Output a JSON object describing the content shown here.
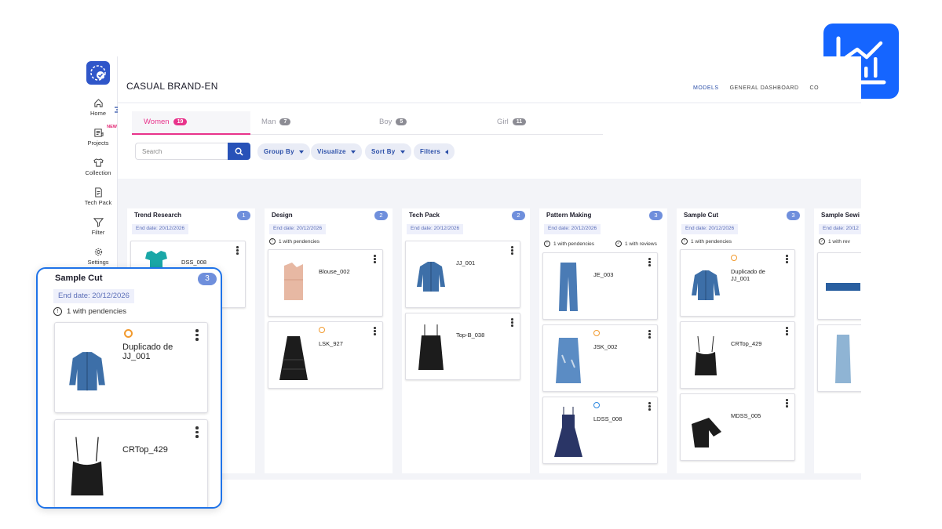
{
  "app": {
    "brand": "CASUAL BRAND-EN",
    "top_nav": [
      "MODELS",
      "GENERAL DASHBOARD",
      "CO"
    ],
    "top_nav_active": "MODELS"
  },
  "sidebar": {
    "items": [
      {
        "label": "Home",
        "icon": "home-icon"
      },
      {
        "label": "Projects",
        "icon": "projects-icon",
        "badge": "NEW"
      },
      {
        "label": "Collection",
        "icon": "shirt-icon"
      },
      {
        "label": "Tech Pack",
        "icon": "techpack-icon"
      },
      {
        "label": "Filter",
        "icon": "filter-icon"
      },
      {
        "label": "Settings",
        "icon": "gear-icon"
      }
    ]
  },
  "tabs": [
    {
      "label": "Women",
      "count": "19"
    },
    {
      "label": "Man",
      "count": "7"
    },
    {
      "label": "Boy",
      "count": "5"
    },
    {
      "label": "Girl",
      "count": "11"
    }
  ],
  "search": {
    "placeholder": "Search"
  },
  "toolbar": {
    "group_by": "Group By",
    "visualize": "Visualize",
    "sort_by": "Sort By",
    "filters": "Filters"
  },
  "columns": [
    {
      "title": "Trend Research",
      "count": "1",
      "end_date": "End date: 20/12/2026",
      "cards": [
        {
          "name": "DSS_008"
        }
      ]
    },
    {
      "title": "Design",
      "count": "2",
      "end_date": "End date: 20/12/2026",
      "pendencies": "1 with pendencies",
      "cards": [
        {
          "name": "Blouse_002"
        },
        {
          "name": "LSK_927",
          "status": "orange"
        }
      ]
    },
    {
      "title": "Tech Pack",
      "count": "2",
      "end_date": "End date: 20/12/2026",
      "cards": [
        {
          "name": "JJ_001"
        },
        {
          "name": "Top-B_038"
        }
      ]
    },
    {
      "title": "Pattern Making",
      "count": "3",
      "end_date": "End date: 20/12/2026",
      "pendencies": "1 with pendencies",
      "reviews": "1 with reviews",
      "cards": [
        {
          "name": "JE_003"
        },
        {
          "name": "JSK_002",
          "status": "orange"
        },
        {
          "name": "LDSS_008",
          "status": "blue"
        }
      ]
    },
    {
      "title": "Sample Cut",
      "count": "3",
      "end_date": "End date: 20/12/2026",
      "pendencies": "1 with pendencies",
      "cards": [
        {
          "name": "Duplicado de JJ_001",
          "status": "orange"
        },
        {
          "name": "CRTop_429"
        },
        {
          "name": "MDSS_005"
        }
      ]
    },
    {
      "title": "Sample Sewi",
      "end_date": "End date: 20/12",
      "reviews": "1 with rev"
    }
  ],
  "zoom_panel": {
    "title": "Sample Cut",
    "count": "3",
    "end_date": "End date: 20/12/2026",
    "pendencies": "1 with pendencies",
    "cards": [
      {
        "name": "Duplicado de JJ_001",
        "status": "orange"
      },
      {
        "name": "CRTop_429"
      }
    ]
  },
  "colors": {
    "accent_pink": "#e8338b",
    "primary_blue": "#2852b8",
    "badge_blue": "#6f8fdc",
    "corner_blue": "#1565ff"
  }
}
